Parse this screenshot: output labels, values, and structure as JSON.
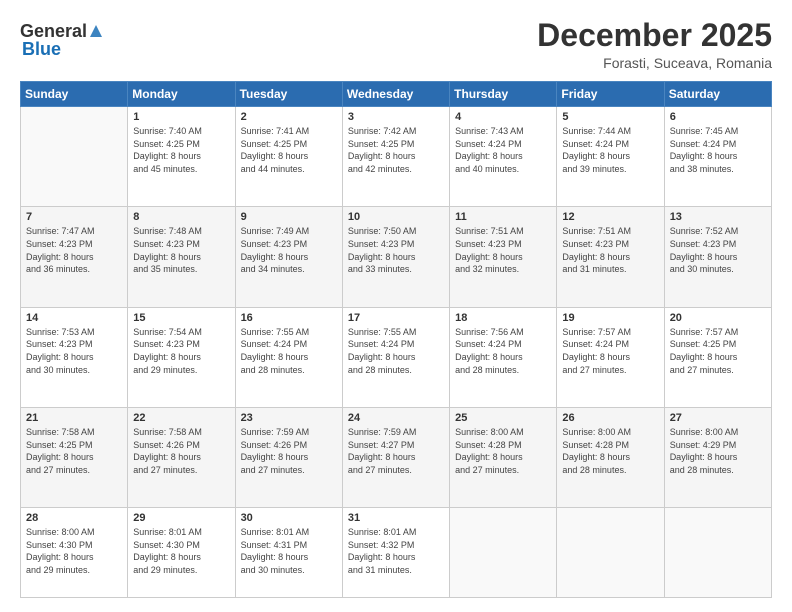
{
  "logo": {
    "general": "General",
    "blue": "Blue"
  },
  "header": {
    "month": "December 2025",
    "location": "Forasti, Suceava, Romania"
  },
  "weekdays": [
    "Sunday",
    "Monday",
    "Tuesday",
    "Wednesday",
    "Thursday",
    "Friday",
    "Saturday"
  ],
  "weeks": [
    [
      {
        "day": "",
        "info": ""
      },
      {
        "day": "1",
        "info": "Sunrise: 7:40 AM\nSunset: 4:25 PM\nDaylight: 8 hours\nand 45 minutes."
      },
      {
        "day": "2",
        "info": "Sunrise: 7:41 AM\nSunset: 4:25 PM\nDaylight: 8 hours\nand 44 minutes."
      },
      {
        "day": "3",
        "info": "Sunrise: 7:42 AM\nSunset: 4:25 PM\nDaylight: 8 hours\nand 42 minutes."
      },
      {
        "day": "4",
        "info": "Sunrise: 7:43 AM\nSunset: 4:24 PM\nDaylight: 8 hours\nand 40 minutes."
      },
      {
        "day": "5",
        "info": "Sunrise: 7:44 AM\nSunset: 4:24 PM\nDaylight: 8 hours\nand 39 minutes."
      },
      {
        "day": "6",
        "info": "Sunrise: 7:45 AM\nSunset: 4:24 PM\nDaylight: 8 hours\nand 38 minutes."
      }
    ],
    [
      {
        "day": "7",
        "info": "Sunrise: 7:47 AM\nSunset: 4:23 PM\nDaylight: 8 hours\nand 36 minutes."
      },
      {
        "day": "8",
        "info": "Sunrise: 7:48 AM\nSunset: 4:23 PM\nDaylight: 8 hours\nand 35 minutes."
      },
      {
        "day": "9",
        "info": "Sunrise: 7:49 AM\nSunset: 4:23 PM\nDaylight: 8 hours\nand 34 minutes."
      },
      {
        "day": "10",
        "info": "Sunrise: 7:50 AM\nSunset: 4:23 PM\nDaylight: 8 hours\nand 33 minutes."
      },
      {
        "day": "11",
        "info": "Sunrise: 7:51 AM\nSunset: 4:23 PM\nDaylight: 8 hours\nand 32 minutes."
      },
      {
        "day": "12",
        "info": "Sunrise: 7:51 AM\nSunset: 4:23 PM\nDaylight: 8 hours\nand 31 minutes."
      },
      {
        "day": "13",
        "info": "Sunrise: 7:52 AM\nSunset: 4:23 PM\nDaylight: 8 hours\nand 30 minutes."
      }
    ],
    [
      {
        "day": "14",
        "info": "Sunrise: 7:53 AM\nSunset: 4:23 PM\nDaylight: 8 hours\nand 30 minutes."
      },
      {
        "day": "15",
        "info": "Sunrise: 7:54 AM\nSunset: 4:23 PM\nDaylight: 8 hours\nand 29 minutes."
      },
      {
        "day": "16",
        "info": "Sunrise: 7:55 AM\nSunset: 4:24 PM\nDaylight: 8 hours\nand 28 minutes."
      },
      {
        "day": "17",
        "info": "Sunrise: 7:55 AM\nSunset: 4:24 PM\nDaylight: 8 hours\nand 28 minutes."
      },
      {
        "day": "18",
        "info": "Sunrise: 7:56 AM\nSunset: 4:24 PM\nDaylight: 8 hours\nand 28 minutes."
      },
      {
        "day": "19",
        "info": "Sunrise: 7:57 AM\nSunset: 4:24 PM\nDaylight: 8 hours\nand 27 minutes."
      },
      {
        "day": "20",
        "info": "Sunrise: 7:57 AM\nSunset: 4:25 PM\nDaylight: 8 hours\nand 27 minutes."
      }
    ],
    [
      {
        "day": "21",
        "info": "Sunrise: 7:58 AM\nSunset: 4:25 PM\nDaylight: 8 hours\nand 27 minutes."
      },
      {
        "day": "22",
        "info": "Sunrise: 7:58 AM\nSunset: 4:26 PM\nDaylight: 8 hours\nand 27 minutes."
      },
      {
        "day": "23",
        "info": "Sunrise: 7:59 AM\nSunset: 4:26 PM\nDaylight: 8 hours\nand 27 minutes."
      },
      {
        "day": "24",
        "info": "Sunrise: 7:59 AM\nSunset: 4:27 PM\nDaylight: 8 hours\nand 27 minutes."
      },
      {
        "day": "25",
        "info": "Sunrise: 8:00 AM\nSunset: 4:28 PM\nDaylight: 8 hours\nand 27 minutes."
      },
      {
        "day": "26",
        "info": "Sunrise: 8:00 AM\nSunset: 4:28 PM\nDaylight: 8 hours\nand 28 minutes."
      },
      {
        "day": "27",
        "info": "Sunrise: 8:00 AM\nSunset: 4:29 PM\nDaylight: 8 hours\nand 28 minutes."
      }
    ],
    [
      {
        "day": "28",
        "info": "Sunrise: 8:00 AM\nSunset: 4:30 PM\nDaylight: 8 hours\nand 29 minutes."
      },
      {
        "day": "29",
        "info": "Sunrise: 8:01 AM\nSunset: 4:30 PM\nDaylight: 8 hours\nand 29 minutes."
      },
      {
        "day": "30",
        "info": "Sunrise: 8:01 AM\nSunset: 4:31 PM\nDaylight: 8 hours\nand 30 minutes."
      },
      {
        "day": "31",
        "info": "Sunrise: 8:01 AM\nSunset: 4:32 PM\nDaylight: 8 hours\nand 31 minutes."
      },
      {
        "day": "",
        "info": ""
      },
      {
        "day": "",
        "info": ""
      },
      {
        "day": "",
        "info": ""
      }
    ]
  ]
}
